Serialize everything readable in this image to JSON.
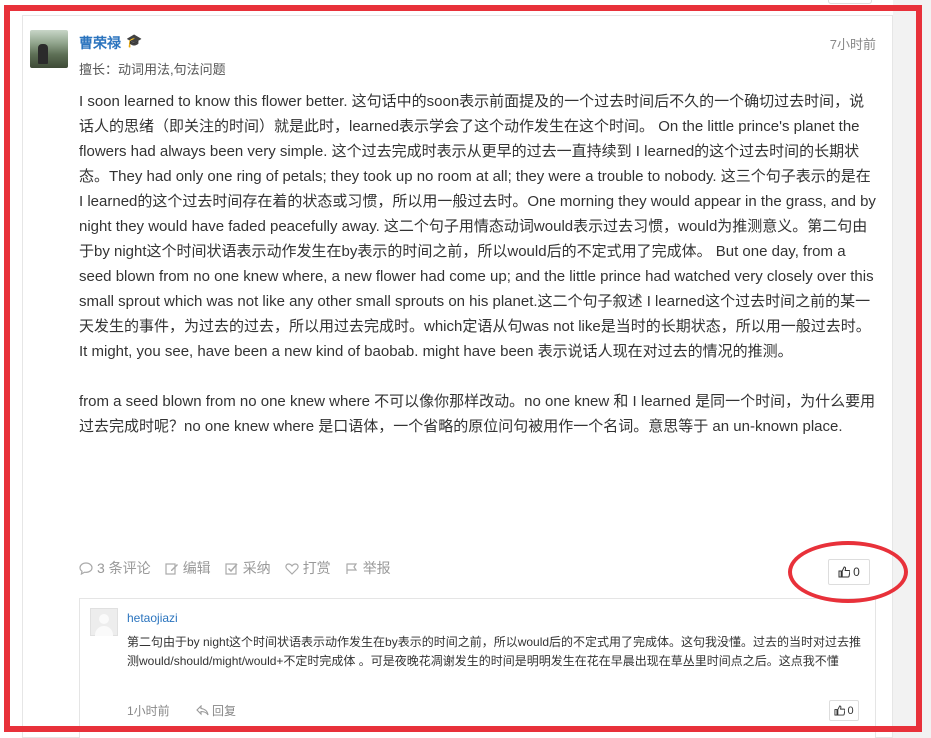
{
  "answer": {
    "author": "曹荣禄",
    "badge_icon": "graduation-cap-icon",
    "specialty": "擅长：动词用法,句法问题",
    "time": "7小时前",
    "paragraphs": [
      "I soon learned to know this flower better. 这句话中的soon表示前面提及的一个过去时间后不久的一个确切过去时间，说话人的思绪（即关注的时间）就是此时，learned表示学会了这个动作发生在这个时间。 On the little prince's planet the flowers had always been very simple. 这个过去完成时表示从更早的过去一直持续到 I learned的这个过去时间的长期状态。They had only one ring of petals; they took up no room at all; they were a trouble to nobody. 这三个句子表示的是在 I learned的这个过去时间存在着的状态或习惯，所以用一般过去时。One morning they would appear in the grass, and by night they would have faded peacefully away. 这二个句子用情态动词would表示过去习惯，would为推测意义。第二句由于by night这个时间状语表示动作发生在by表示的时间之前，所以would后的不定式用了完成体。 But one day, from a seed blown from no one knew where, a new flower had come up; and the little prince had watched very closely over this small sprout which was not like any other small sprouts on his planet.这二个句子叙述 I learned这个过去时间之前的某一天发生的事件，为过去的过去，所以用过去完成时。which定语从句was not like是当时的长期状态，所以用一般过去时。 It might, you see, have been a new kind of baobab. might have been 表示说话人现在对过去的情况的推测。",
      "from a seed blown from no one knew where 不可以像你那样改动。no one knew 和 I learned 是同一个时间，为什么要用过去完成时呢？no one knew where 是口语体，一个省略的原位问句被用作一个名词。意思等于 an un-known place."
    ],
    "actions": {
      "comments": "3 条评论",
      "edit": "编辑",
      "adopt": "采纳",
      "tip": "打赏",
      "report": "举报"
    },
    "like_count": "0"
  },
  "reply": {
    "user": "hetaojiazi",
    "text": "第二句由于by night这个时间状语表示动作发生在by表示的时间之前，所以would后的不定式用了完成体。这句我没懂。过去的当时对过去推测would/should/might/would+不定时完成体 。可是夜晚花凋谢发生的时间是明明发生在花在早晨出现在草丛里时间点之后。这点我不懂",
    "time": "1小时前",
    "reply_label": "回复",
    "like_count": "0"
  },
  "colors": {
    "highlight": "#e8313a",
    "link": "#2b74be",
    "badge": "#f39c12"
  }
}
